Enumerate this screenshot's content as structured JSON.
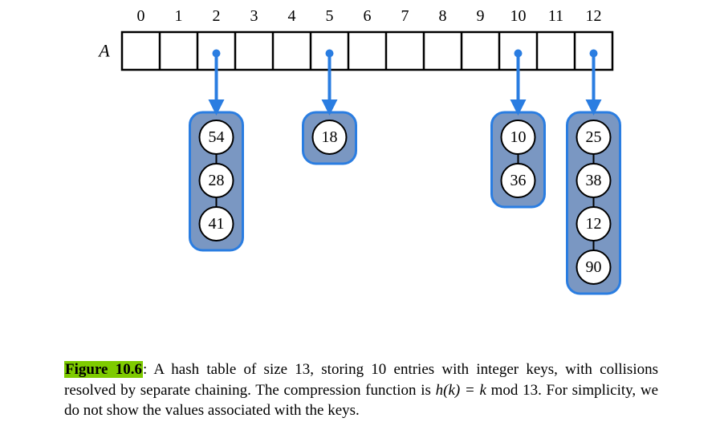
{
  "diagram": {
    "array_label": "A",
    "size": 13,
    "indices": [
      "0",
      "1",
      "2",
      "3",
      "4",
      "5",
      "6",
      "7",
      "8",
      "9",
      "10",
      "11",
      "12"
    ],
    "buckets": [
      {
        "slot": 2,
        "chain": [
          "54",
          "28",
          "41"
        ]
      },
      {
        "slot": 5,
        "chain": [
          "18"
        ]
      },
      {
        "slot": 10,
        "chain": [
          "10",
          "36"
        ]
      },
      {
        "slot": 12,
        "chain": [
          "25",
          "38",
          "12",
          "90"
        ]
      }
    ],
    "colors": {
      "stroke": "#2a7de1",
      "bucket_fill": "#7a97c2",
      "array_stroke": "#000",
      "node_fill": "#fff"
    }
  },
  "caption": {
    "figure_label": "Figure 10.6",
    "text_before_hk": ": A hash table of size 13, storing 10 entries with integer keys, with collisions resolved by separate chaining. The compression function is ",
    "hk_expr": "h(k) = k",
    "text_after_hk": " mod 13. For simplicity, we do not show the values associated with the keys."
  }
}
